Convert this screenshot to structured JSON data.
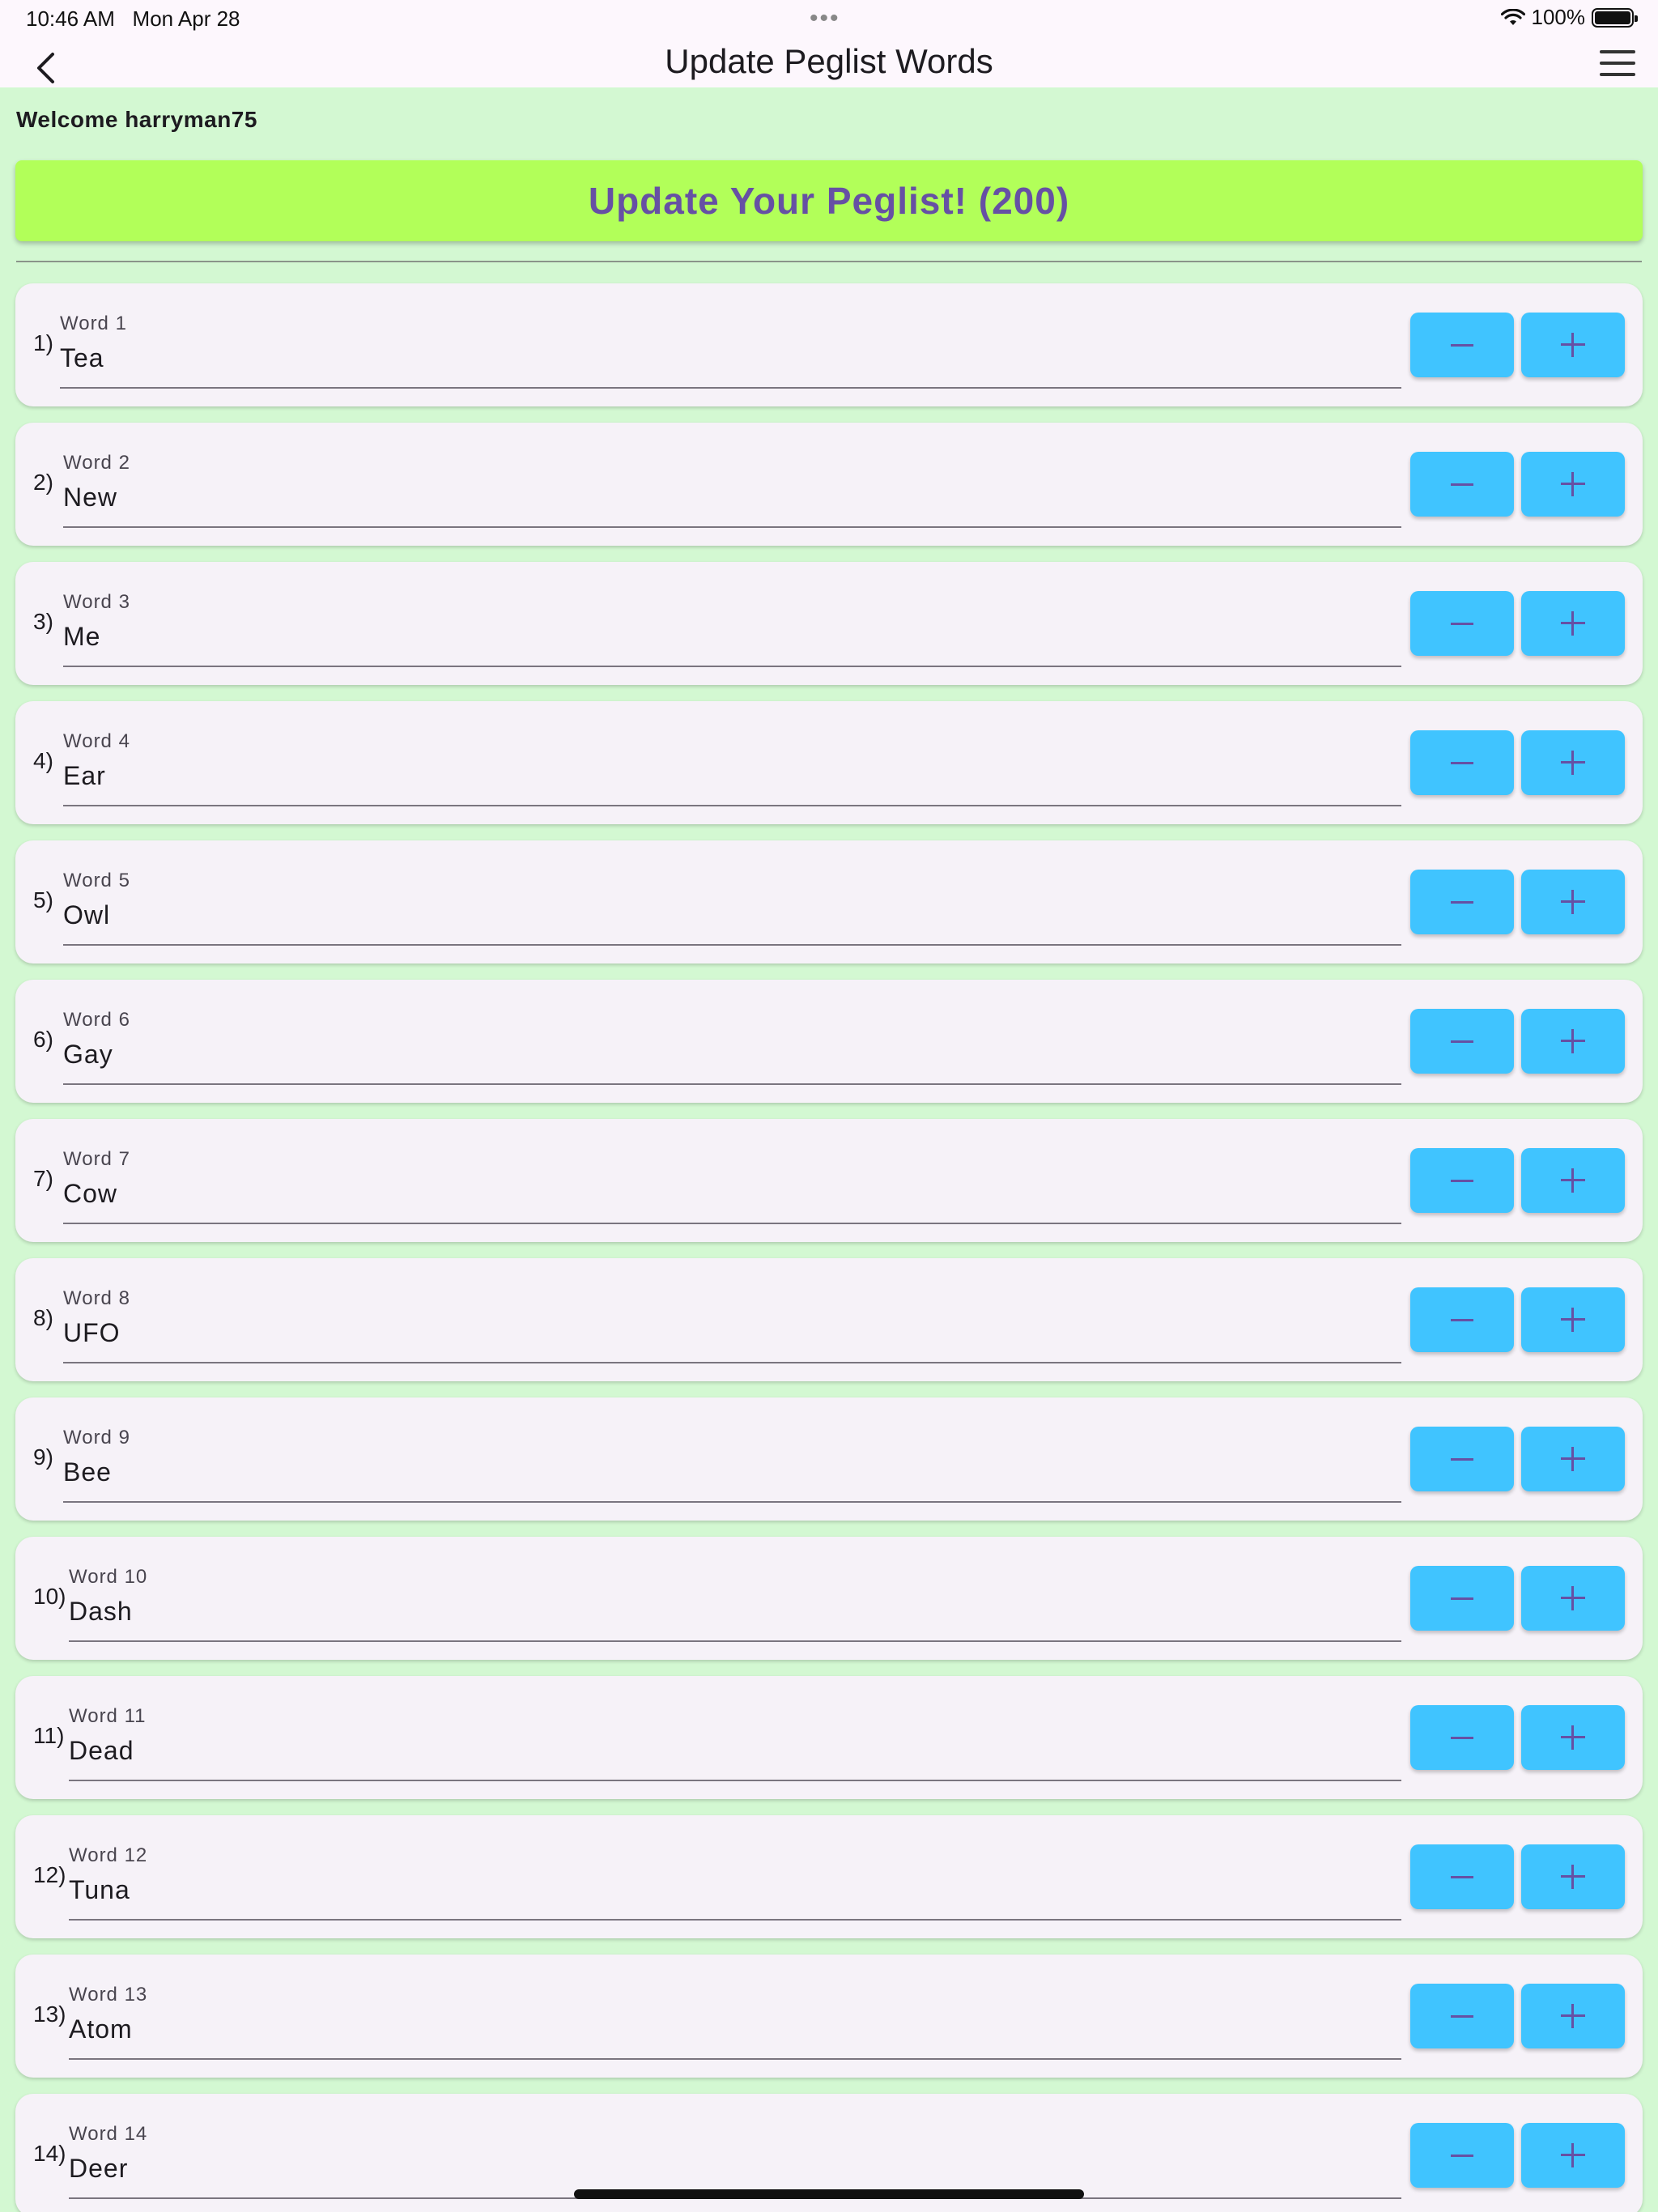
{
  "status_bar": {
    "time": "10:46 AM",
    "date": "Mon Apr 28",
    "battery": "100%"
  },
  "header": {
    "title": "Update Peglist Words"
  },
  "welcome": "Welcome harryman75",
  "update_button_label": "Update Your Peglist! (200)",
  "words": [
    {
      "number": "1)",
      "label": "Word 1",
      "value": "Tea"
    },
    {
      "number": "2)",
      "label": "Word 2",
      "value": "New"
    },
    {
      "number": "3)",
      "label": "Word 3",
      "value": "Me"
    },
    {
      "number": "4)",
      "label": "Word 4",
      "value": "Ear"
    },
    {
      "number": "5)",
      "label": "Word 5",
      "value": "Owl"
    },
    {
      "number": "6)",
      "label": "Word 6",
      "value": "Gay"
    },
    {
      "number": "7)",
      "label": "Word 7",
      "value": "Cow"
    },
    {
      "number": "8)",
      "label": "Word 8",
      "value": "UFO"
    },
    {
      "number": "9)",
      "label": "Word 9",
      "value": "Bee"
    },
    {
      "number": "10)",
      "label": "Word 10",
      "value": "Dash"
    },
    {
      "number": "11)",
      "label": "Word 11",
      "value": "Dead"
    },
    {
      "number": "12)",
      "label": "Word 12",
      "value": "Tuna"
    },
    {
      "number": "13)",
      "label": "Word 13",
      "value": "Atom"
    },
    {
      "number": "14)",
      "label": "Word 14",
      "value": "Deer"
    }
  ],
  "colors": {
    "background": "#d3f8d2",
    "update_button": "#b2ff59",
    "update_text": "#6650a4",
    "stepper_button": "#40c4ff"
  }
}
